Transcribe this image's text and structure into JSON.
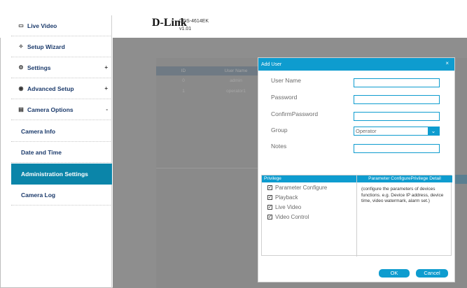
{
  "header": {
    "logo": "D-Link",
    "model": "DCS-4614EK",
    "version": "v1.01"
  },
  "sidebar": {
    "items": [
      {
        "label": "Live Video",
        "icon": "video-icon"
      },
      {
        "label": "Setup Wizard",
        "icon": "wizard-icon"
      },
      {
        "label": "Settings",
        "icon": "gear-icon",
        "toggle": "+"
      },
      {
        "label": "Advanced Setup",
        "icon": "advanced-icon",
        "toggle": "+"
      },
      {
        "label": "Camera Options",
        "icon": "camera-options-icon",
        "toggle": "-"
      }
    ],
    "sub_items": [
      {
        "label": "Camera Info"
      },
      {
        "label": "Date and Time"
      },
      {
        "label": "Administration Settings"
      },
      {
        "label": "Camera Log"
      }
    ]
  },
  "background_table": {
    "headers": [
      "ID",
      "User Name"
    ],
    "rows": [
      [
        "0",
        "admin"
      ],
      [
        "1",
        "operator1"
      ]
    ]
  },
  "modal": {
    "title": "Add User",
    "close": "×",
    "fields": {
      "username_label": "User Name",
      "username_value": "",
      "password_label": "Password",
      "password_value": "",
      "confirm_label": "ConfirmPassword",
      "confirm_value": "",
      "group_label": "Group",
      "group_value": "Operator",
      "notes_label": "Notes",
      "notes_value": ""
    },
    "privilege": {
      "header": "Privilege",
      "detail_header": "Parameter ConfigurePrivilege Detail",
      "items": [
        {
          "label": "Parameter Configure",
          "checked": true
        },
        {
          "label": "Playback",
          "checked": true
        },
        {
          "label": "Live Video",
          "checked": true
        },
        {
          "label": "Video Control",
          "checked": true
        }
      ],
      "detail_text": "(configure the parameters of devices functions. e.g. Device IP address, device time, video watermark, alarm set.)"
    },
    "ok_label": "OK",
    "cancel_label": "Cancel"
  },
  "colors": {
    "accent": "#0e9ccf",
    "active_sidebar": "#0b85a9",
    "sidebar_text": "#1b3a6b",
    "overlay": "#8e8e8e"
  }
}
